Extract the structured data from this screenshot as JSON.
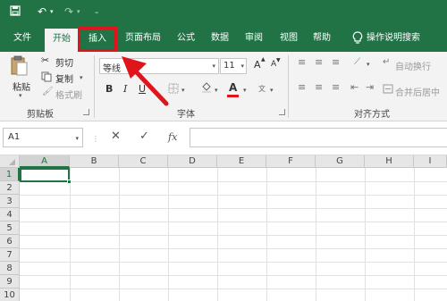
{
  "tabs": {
    "file": "文件",
    "home": "开始",
    "insert": "插入",
    "layout": "页面布局",
    "formulas": "公式",
    "data": "数据",
    "review": "审阅",
    "view": "视图",
    "help": "帮助",
    "tell_me": "操作说明搜索"
  },
  "clipboard": {
    "paste": "粘贴",
    "cut": "剪切",
    "copy": "复制",
    "format_painter": "格式刷",
    "label": "剪贴板"
  },
  "font": {
    "name": "等线",
    "size": "11",
    "grow": "A",
    "shrink": "A",
    "bold": "B",
    "italic": "I",
    "underline": "U",
    "font_color": "A",
    "label": "字体"
  },
  "alignment": {
    "wrap_text": "自动换行",
    "merge_center": "合并后居中",
    "label": "对齐方式"
  },
  "formula_bar": {
    "name_box": "A1",
    "fx": "fx",
    "value": ""
  },
  "grid": {
    "columns": [
      "A",
      "B",
      "C",
      "D",
      "E",
      "F",
      "G",
      "H",
      "I"
    ],
    "rows": [
      "1",
      "2",
      "3",
      "4",
      "5",
      "6",
      "7",
      "8",
      "9",
      "10"
    ]
  },
  "colors": {
    "accent": "#217346",
    "highlight": "#e0151c"
  }
}
